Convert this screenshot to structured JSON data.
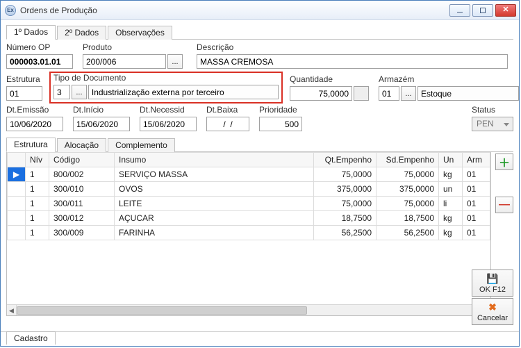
{
  "title": "Ordens de Produção",
  "tabs_top": [
    "1º Dados",
    "2º Dados",
    "Observações"
  ],
  "tabs_top_active": 0,
  "labels": {
    "numero_op": "Número OP",
    "produto": "Produto",
    "descricao": "Descrição",
    "estrutura": "Estrutura",
    "tipo_doc": "Tipo de Documento",
    "quantidade": "Quantidade",
    "armazem": "Armazém",
    "dt_emissao": "Dt.Emissão",
    "dt_inicio": "Dt.Início",
    "dt_necessid": "Dt.Necessid",
    "dt_baixa": "Dt.Baixa",
    "prioridade": "Prioridade",
    "status": "Status"
  },
  "values": {
    "numero_op": "000003.01.01",
    "produto": "200/006",
    "descricao": "MASSA CREMOSA",
    "estrutura": "01",
    "tipo_doc_code": "3",
    "tipo_doc_desc": "Industrialização externa por terceiro",
    "quantidade": "75,0000",
    "armazem_code": "01",
    "armazem_desc": "Estoque",
    "dt_emissao": "10/06/2020",
    "dt_inicio": "15/06/2020",
    "dt_necessid": "15/06/2020",
    "dt_baixa": "/  /",
    "prioridade": "500",
    "status": "PEN"
  },
  "tabs_inner": [
    "Estrutura",
    "Alocação",
    "Complemento"
  ],
  "tabs_inner_active": 0,
  "grid": {
    "columns": [
      "Nív",
      "Código",
      "Insumo",
      "Qt.Empenho",
      "Sd.Empenho",
      "Un",
      "Arm"
    ],
    "rows": [
      {
        "niv": "1",
        "codigo": "800/002",
        "insumo": "SERVIÇO MASSA",
        "qt": "75,0000",
        "sd": "75,0000",
        "un": "kg",
        "arm": "01",
        "selected": true
      },
      {
        "niv": "1",
        "codigo": "300/010",
        "insumo": "OVOS",
        "qt": "375,0000",
        "sd": "375,0000",
        "un": "un",
        "arm": "01"
      },
      {
        "niv": "1",
        "codigo": "300/011",
        "insumo": "LEITE",
        "qt": "75,0000",
        "sd": "75,0000",
        "un": "li",
        "arm": "01"
      },
      {
        "niv": "1",
        "codigo": "300/012",
        "insumo": "AÇUCAR",
        "qt": "18,7500",
        "sd": "18,7500",
        "un": "kg",
        "arm": "01"
      },
      {
        "niv": "1",
        "codigo": "300/009",
        "insumo": "FARINHA",
        "qt": "56,2500",
        "sd": "56,2500",
        "un": "kg",
        "arm": "01"
      }
    ]
  },
  "actions": {
    "ok": "OK  F12",
    "cancel": "Cancelar"
  },
  "bottom_tab": "Cadastro",
  "icons": {
    "app": "Ex",
    "ellipsis": "..."
  }
}
